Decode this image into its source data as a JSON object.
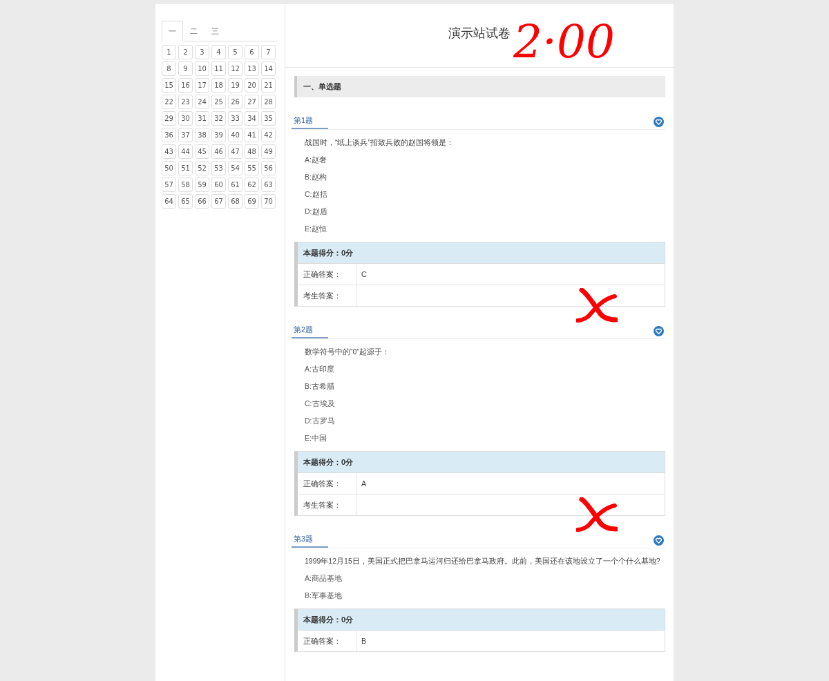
{
  "sidebar": {
    "tabs": [
      {
        "label": "一",
        "selected": true
      },
      {
        "label": "二",
        "selected": false
      },
      {
        "label": "三",
        "selected": false
      }
    ],
    "numbers": [
      "1",
      "2",
      "3",
      "4",
      "5",
      "6",
      "7",
      "8",
      "9",
      "10",
      "11",
      "12",
      "13",
      "14",
      "15",
      "16",
      "17",
      "18",
      "19",
      "20",
      "21",
      "22",
      "23",
      "24",
      "25",
      "26",
      "27",
      "28",
      "29",
      "30",
      "31",
      "32",
      "33",
      "34",
      "35",
      "36",
      "37",
      "38",
      "39",
      "40",
      "41",
      "42",
      "43",
      "44",
      "45",
      "46",
      "47",
      "48",
      "49",
      "50",
      "51",
      "52",
      "53",
      "54",
      "55",
      "56",
      "57",
      "58",
      "59",
      "60",
      "61",
      "62",
      "63",
      "64",
      "65",
      "66",
      "67",
      "68",
      "69",
      "70"
    ]
  },
  "header": {
    "title": "演示站试卷",
    "total_score": "2·00"
  },
  "section": {
    "title": "一、单选题"
  },
  "questions": [
    {
      "label": "第1题",
      "text": "战国时，“纸上谈兵”招致兵败的赵国将领是：",
      "options": [
        "A:赵奢",
        "B:赵构",
        "C:赵括",
        "D:赵盾",
        "E:赵恒"
      ],
      "score": "本题得分：0分",
      "correct_label": "正确答案：",
      "correct": "C",
      "student_label": "考生答案：",
      "marked_wrong": true
    },
    {
      "label": "第2题",
      "text": "数学符号中的“0”起源于：",
      "options": [
        "A:古印度",
        "B:古希腊",
        "C:古埃及",
        "D:古罗马",
        "E:中国"
      ],
      "score": "本题得分：0分",
      "correct_label": "正确答案：",
      "correct": "A",
      "student_label": "考生答案：",
      "marked_wrong": true
    },
    {
      "label": "第3题",
      "text": "1999年12月15日，美国正式把巴拿马运河归还给巴拿马政府。此前，美国还在该地设立了一个个什么基地?",
      "options": [
        "A:商品基地",
        "B:军事基地"
      ],
      "score": "本题得分：0分",
      "correct_label": "正确答案：",
      "correct": "B"
    }
  ]
}
